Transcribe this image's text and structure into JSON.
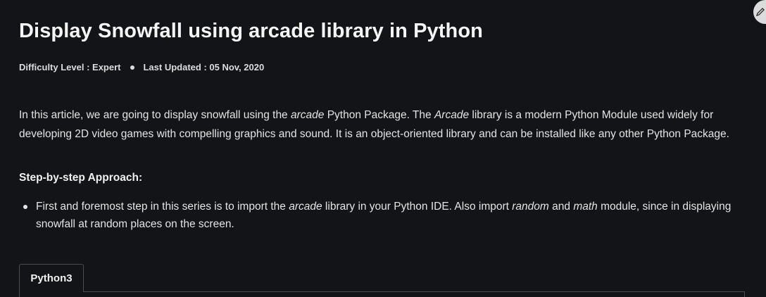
{
  "article": {
    "title": "Display Snowfall using arcade library in Python",
    "meta": {
      "difficulty": "Difficulty Level : Expert",
      "updated": "Last Updated : 05 Nov, 2020"
    },
    "intro": {
      "p1": "In this article, we are going to display snowfall using the ",
      "em1": "arcade",
      "p2": " Python Package. The ",
      "em2": "Arcade",
      "p3": " library is a modern Python Module used widely for developing 2D video games with compelling graphics and sound. It is an object-oriented library and can be installed like any other Python Package."
    },
    "section_heading": "Step-by-step Approach:",
    "steps": [
      {
        "p1": "First and foremost step in this series is to import the ",
        "em1": "arcade",
        "p2": " library in your Python IDE. Also import ",
        "em2": "random",
        "p3": " and ",
        "em3": "math",
        "p4": " module, since in displaying snowfall at random places on the screen."
      }
    ],
    "code_tabs": [
      {
        "label": "Python3"
      }
    ]
  },
  "icons": {
    "corner": "edit-pencil-icon"
  },
  "colors": {
    "background": "#131417",
    "text": "#e4e4e4",
    "border": "#4a4c52"
  }
}
